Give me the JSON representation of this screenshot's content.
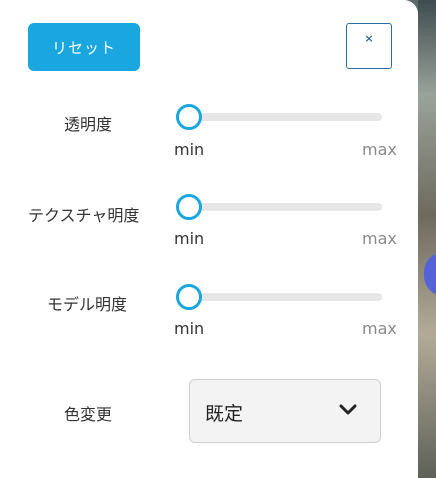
{
  "controls": {
    "reset_label": "リセット",
    "close_symbol": "×"
  },
  "sliders": [
    {
      "label": "透明度",
      "min_label": "min",
      "max_label": "max",
      "value": 0
    },
    {
      "label": "テクスチャ明度",
      "min_label": "min",
      "max_label": "max",
      "value": 0
    },
    {
      "label": "モデル明度",
      "min_label": "min",
      "max_label": "max",
      "value": 0
    }
  ],
  "color_change": {
    "label": "色変更",
    "selected": "既定"
  },
  "colors": {
    "accent": "#1aa7e0",
    "close_border": "#2b6ea3",
    "side_bubble": "#5563d9"
  }
}
